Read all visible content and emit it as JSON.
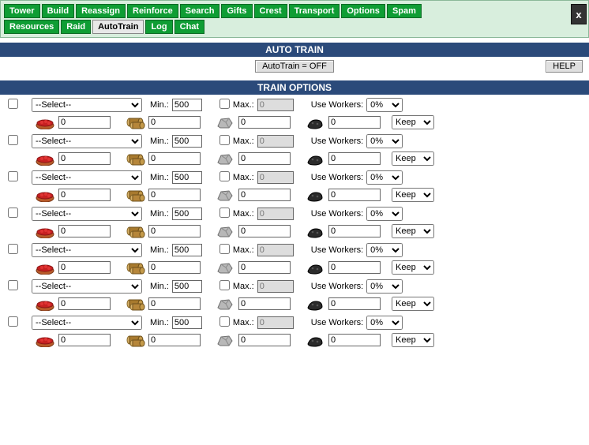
{
  "nav": {
    "row1": [
      "Tower",
      "Build",
      "Reassign",
      "Reinforce",
      "Search",
      "Gifts",
      "Crest",
      "Transport",
      "Options",
      "Spam"
    ],
    "row2": [
      "Resources",
      "Raid",
      "AutoTrain",
      "Log",
      "Chat"
    ],
    "active": "AutoTrain",
    "close_label": "x"
  },
  "sections": {
    "autotrain_title": "AUTO TRAIN",
    "train_options_title": "TRAIN OPTIONS"
  },
  "controls": {
    "autotrain_toggle": "AutoTrain = OFF",
    "help": "HELP"
  },
  "labels": {
    "select_placeholder": "--Select--",
    "min": "Min.:",
    "max": "Max.:",
    "use_workers": "Use Workers:",
    "keep": "Keep"
  },
  "defaults": {
    "min_value": "500",
    "max_value": "0",
    "worker_pct": "0%",
    "res_value": "0"
  },
  "chart_data": {
    "type": "table",
    "title": "TRAIN OPTIONS",
    "columns": [
      "enabled",
      "unit",
      "min",
      "max_enabled",
      "max",
      "workers_pct",
      "food",
      "wood",
      "stone",
      "ore",
      "keep"
    ],
    "rows": [
      {
        "enabled": false,
        "unit": "--Select--",
        "min": 500,
        "max_enabled": false,
        "max": 0,
        "workers_pct": "0%",
        "food": 0,
        "wood": 0,
        "stone": 0,
        "ore": 0,
        "keep": "Keep"
      },
      {
        "enabled": false,
        "unit": "--Select--",
        "min": 500,
        "max_enabled": false,
        "max": 0,
        "workers_pct": "0%",
        "food": 0,
        "wood": 0,
        "stone": 0,
        "ore": 0,
        "keep": "Keep"
      },
      {
        "enabled": false,
        "unit": "--Select--",
        "min": 500,
        "max_enabled": false,
        "max": 0,
        "workers_pct": "0%",
        "food": 0,
        "wood": 0,
        "stone": 0,
        "ore": 0,
        "keep": "Keep"
      },
      {
        "enabled": false,
        "unit": "--Select--",
        "min": 500,
        "max_enabled": false,
        "max": 0,
        "workers_pct": "0%",
        "food": 0,
        "wood": 0,
        "stone": 0,
        "ore": 0,
        "keep": "Keep"
      },
      {
        "enabled": false,
        "unit": "--Select--",
        "min": 500,
        "max_enabled": false,
        "max": 0,
        "workers_pct": "0%",
        "food": 0,
        "wood": 0,
        "stone": 0,
        "ore": 0,
        "keep": "Keep"
      },
      {
        "enabled": false,
        "unit": "--Select--",
        "min": 500,
        "max_enabled": false,
        "max": 0,
        "workers_pct": "0%",
        "food": 0,
        "wood": 0,
        "stone": 0,
        "ore": 0,
        "keep": "Keep"
      },
      {
        "enabled": false,
        "unit": "--Select--",
        "min": 500,
        "max_enabled": false,
        "max": 0,
        "workers_pct": "0%",
        "food": 0,
        "wood": 0,
        "stone": 0,
        "ore": 0,
        "keep": "Keep"
      }
    ]
  },
  "colors": {
    "nav_green": "#0f9d34",
    "nav_bg": "#d8eedd",
    "section_bar": "#2b4a7a"
  }
}
